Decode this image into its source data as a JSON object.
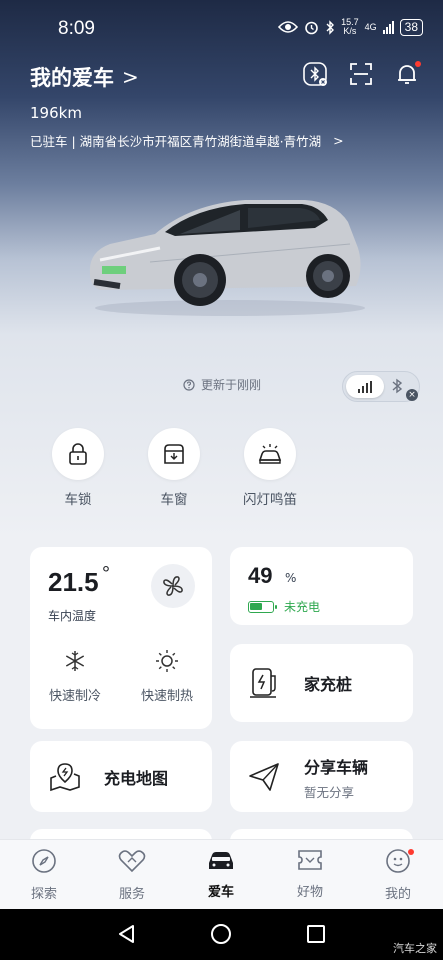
{
  "status_bar": {
    "time": "8:09",
    "net_speed_value": "15.7",
    "net_speed_unit": "K/s",
    "network": "4G",
    "battery": "38"
  },
  "header": {
    "title": "我的爱车",
    "title_chevron": ">",
    "icons": [
      "bluetooth-off-icon",
      "scan-icon",
      "bell-icon"
    ]
  },
  "vehicle": {
    "range": "196km",
    "location": "已驻车 | 湖南省长沙市开福区青竹湖街道卓越·青竹湖",
    "location_chevron": ">",
    "updated": "更新于刚刚"
  },
  "quick_actions": [
    {
      "label": "车锁",
      "icon": "lock-icon"
    },
    {
      "label": "车窗",
      "icon": "window-icon"
    },
    {
      "label": "闪灯鸣笛",
      "icon": "flash-horn-icon"
    }
  ],
  "climate": {
    "temperature": "21.5",
    "degree_symbol": "°",
    "label": "车内温度",
    "modes": [
      {
        "label": "快速制冷",
        "icon": "snowflake-icon"
      },
      {
        "label": "快速制热",
        "icon": "sun-icon"
      }
    ]
  },
  "battery": {
    "percent": "49",
    "unit": "%",
    "level": 0.49,
    "status": "未充电",
    "color": "#2fa84f"
  },
  "cards": {
    "home_charger": "家充桩",
    "charge_map": "充电地图",
    "share_vehicle": "分享车辆",
    "share_status": "暂无分享"
  },
  "tabs": [
    {
      "label": "探索",
      "icon": "compass-icon",
      "active": false
    },
    {
      "label": "服务",
      "icon": "service-icon",
      "active": false
    },
    {
      "label": "爱车",
      "icon": "car-icon",
      "active": true
    },
    {
      "label": "好物",
      "icon": "ticket-icon",
      "active": false
    },
    {
      "label": "我的",
      "icon": "profile-icon",
      "active": false
    }
  ],
  "watermark": "汽车之家",
  "colors": {
    "accent_green": "#2fa84f",
    "notification_red": "#ff3b30",
    "hero_top": "#1e2a45"
  }
}
